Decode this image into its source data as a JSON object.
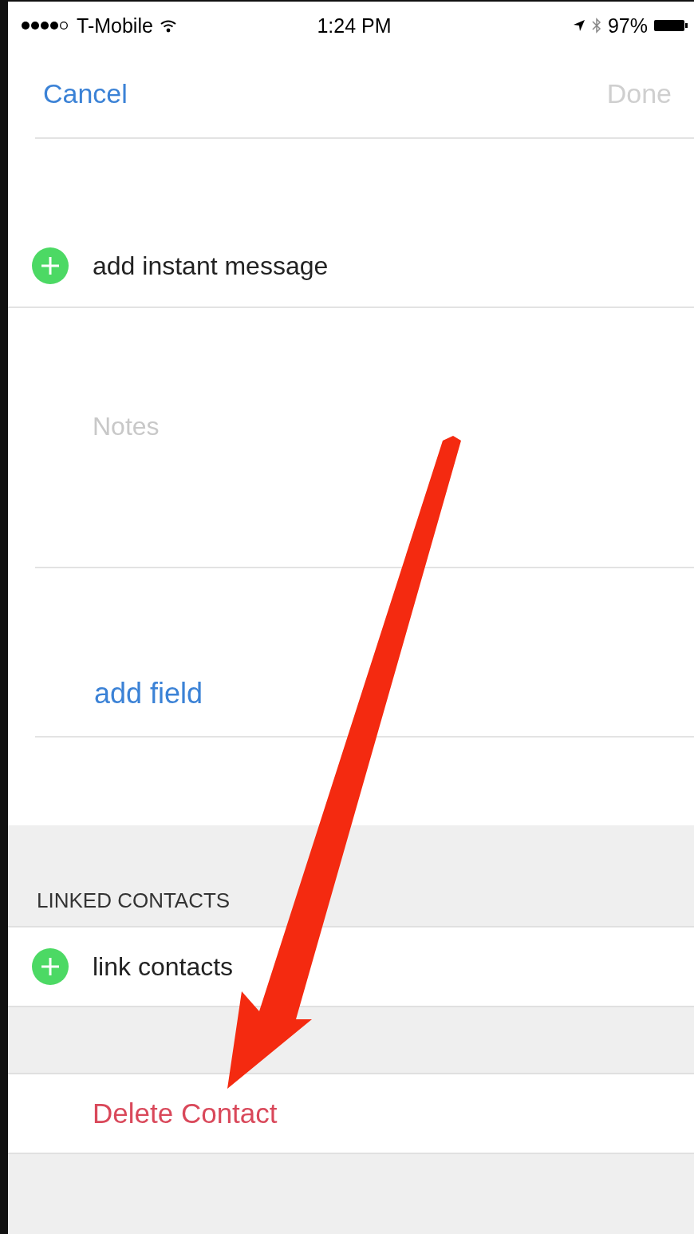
{
  "status_bar": {
    "carrier": "T-Mobile",
    "time": "1:24 PM",
    "battery": "97%"
  },
  "nav": {
    "cancel": "Cancel",
    "done": {
      "label": "Done",
      "disabled": true
    }
  },
  "rows": [
    {
      "kind": "add",
      "label": "add instant message"
    },
    {
      "kind": "notes",
      "placeholder": "Notes"
    },
    {
      "kind": "link",
      "label": "add field"
    }
  ],
  "linked_section": {
    "header": "LINKED CONTACTS",
    "rows": [
      {
        "kind": "add",
        "label": "link contacts"
      }
    ]
  },
  "delete_button": {
    "label": "Delete Contact"
  }
}
